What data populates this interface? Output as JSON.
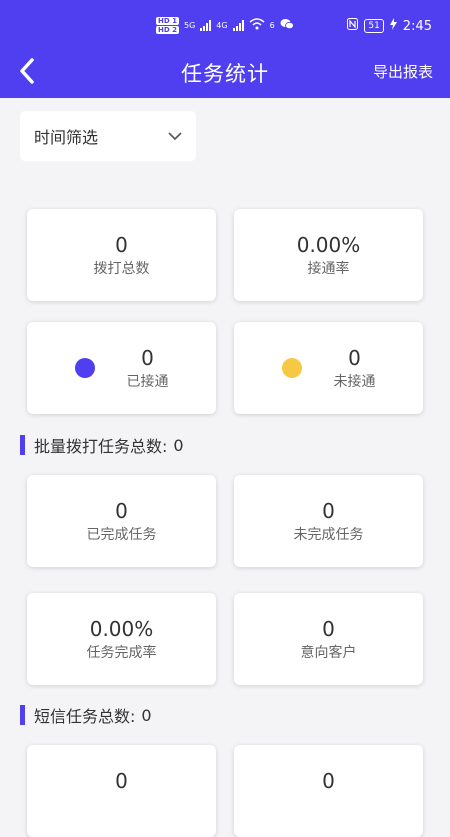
{
  "status_bar": {
    "hd1": "HD 1",
    "hd2": "HD 2",
    "net1": "5G",
    "net2": "4G",
    "wifi": "6",
    "battery": "51",
    "time": "2:45"
  },
  "header": {
    "title": "任务统计",
    "export_label": "导出报表",
    "background_color": "#4f3ff0"
  },
  "filter": {
    "label": "时间筛选"
  },
  "overview": {
    "total_calls": {
      "value": "0",
      "label": "拨打总数"
    },
    "connect_rate": {
      "value": "0.00%",
      "label": "接通率"
    },
    "connected": {
      "value": "0",
      "label": "已接通",
      "dot_color": "#4f3ff0"
    },
    "not_connected": {
      "value": "0",
      "label": "未接通",
      "dot_color": "#f7c844"
    }
  },
  "batch_section": {
    "title": "批量拨打任务总数:",
    "count": "0",
    "completed": {
      "value": "0",
      "label": "已完成任务"
    },
    "uncompleted": {
      "value": "0",
      "label": "未完成任务"
    },
    "completion_rate": {
      "value": "0.00%",
      "label": "任务完成率"
    },
    "intent_customers": {
      "value": "0",
      "label": "意向客户"
    }
  },
  "sms_section": {
    "title": "短信任务总数:",
    "count": "0",
    "card1_value": "0",
    "card2_value": "0"
  }
}
